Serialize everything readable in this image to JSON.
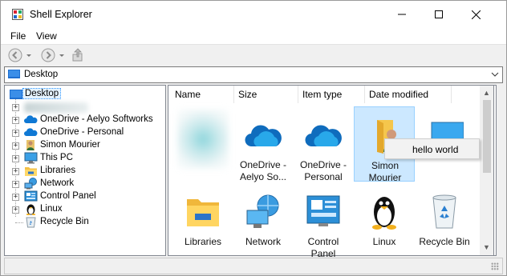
{
  "window": {
    "title": "Shell Explorer",
    "icon": "app-window-icon"
  },
  "caption_buttons": [
    {
      "name": "minimize",
      "icon": "minimize-icon"
    },
    {
      "name": "maximize",
      "icon": "maximize-icon"
    },
    {
      "name": "close",
      "icon": "close-icon"
    }
  ],
  "menu": {
    "file": "File",
    "view": "View"
  },
  "toolbar": {
    "back_icon": "back-arrow-icon",
    "forward_icon": "forward-arrow-icon",
    "up_icon": "up-folder-icon"
  },
  "address": {
    "value": "Desktop",
    "icon": "desktop-icon"
  },
  "tree": {
    "items": [
      {
        "label": "Desktop",
        "icon": "desktop-icon",
        "selected": true
      },
      {
        "label": "",
        "icon": "",
        "redacted": true
      },
      {
        "label": "OneDrive - Aelyo Softworks",
        "icon": "cloud-icon"
      },
      {
        "label": "OneDrive - Personal",
        "icon": "cloud-icon"
      },
      {
        "label": "Simon Mourier",
        "icon": "user-folder-icon"
      },
      {
        "label": "This PC",
        "icon": "computer-icon"
      },
      {
        "label": "Libraries",
        "icon": "libraries-icon"
      },
      {
        "label": "Network",
        "icon": "network-icon"
      },
      {
        "label": "Control Panel",
        "icon": "control-panel-icon"
      },
      {
        "label": "Linux",
        "icon": "linux-penguin-icon"
      },
      {
        "label": "Recycle Bin",
        "icon": "recycle-bin-icon"
      }
    ]
  },
  "columns": [
    "Name",
    "Size",
    "Item type",
    "Date modified"
  ],
  "items": [
    {
      "label": "",
      "icon": "blurred-image",
      "redacted": true
    },
    {
      "label": "OneDrive -\nAelyo So...",
      "icon": "cloud-icon"
    },
    {
      "label": "OneDrive -\nPersonal",
      "icon": "cloud-icon"
    },
    {
      "label": "Simon\nMourier",
      "icon": "user-folder-icon",
      "selected": true
    },
    {
      "label": "",
      "icon": "computer-icon"
    },
    {
      "label": "Libraries",
      "icon": "libraries-icon"
    },
    {
      "label": "Network",
      "icon": "network-icon"
    },
    {
      "label": "Control\nPanel",
      "icon": "control-panel-icon"
    },
    {
      "label": "Linux",
      "icon": "linux-penguin-icon"
    },
    {
      "label": "Recycle Bin",
      "icon": "recycle-bin-icon"
    }
  ],
  "tooltip": {
    "text": "hello world"
  }
}
